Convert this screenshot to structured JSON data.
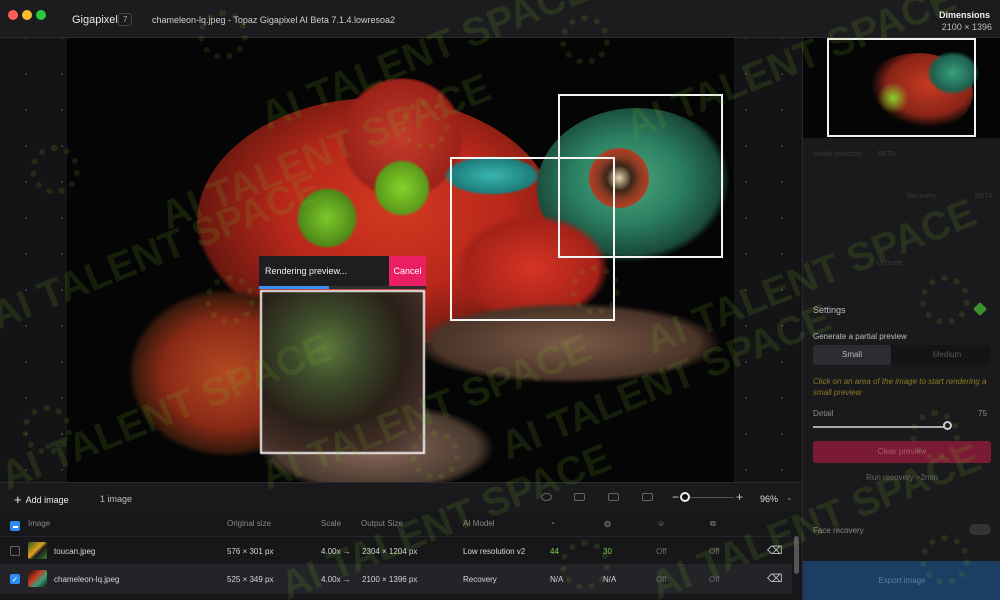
{
  "titlebar": {
    "app_name": "Gigapixel",
    "app_count": "7",
    "window_title": "chameleon-lq.jpeg - Topaz Gigapixel AI Beta 7.1.4.lowresoa2",
    "dimensions_label": "Dimensions",
    "dimensions_value": "2100 × 1396"
  },
  "preview": {
    "status_text": "Rendering preview...",
    "cancel_label": "Cancel",
    "progress_fraction": 0.42
  },
  "toolbar": {
    "add_image_label": "Add image",
    "image_count": "1 image",
    "zoom_value": "96%",
    "icons": [
      "eye-icon",
      "single-view-icon",
      "split-view-icon",
      "side-by-side-icon"
    ]
  },
  "table": {
    "headers": [
      "Image",
      "Original size",
      "Scale",
      "Output Size",
      "AI Model"
    ],
    "rows": [
      {
        "name": "toucan.jpeg",
        "original": "576 × 301 px",
        "scale": "4.00x →",
        "output": "2304 × 1204 px",
        "model": "Low resolution v2",
        "val1": "44",
        "val2": "30",
        "val3": "Off",
        "val4": "Off",
        "checked": false
      },
      {
        "name": "chameleon-lq.jpeg",
        "original": "525 × 349 px",
        "scale": "4.00x →",
        "output": "2100 × 1396 px",
        "model": "Recovery",
        "val1": "N/A",
        "val2": "N/A",
        "val3": "Off",
        "val4": "Off",
        "checked": true
      }
    ]
  },
  "panel": {
    "settings_title": "Settings",
    "partial_label": "Generate a partial preview",
    "seg_small": "Small",
    "seg_medium": "Medium",
    "hint": "Click on an area of the image to start rendering a small preview",
    "detail_label": "Detail",
    "detail_value": "75",
    "detail_fraction": 0.75,
    "clear_preview": "Clear preview",
    "run_recovery": "Run recovery ~2min",
    "face_recovery": "Face recovery",
    "export_label": "Export image",
    "recovery_label": "Recovery",
    "beta_label": "BETA"
  },
  "colors": {
    "accent_pink": "#e91e63",
    "accent_blue": "#2d8cf0",
    "value_green": "#7bd34b"
  },
  "watermark": "AI TALENT SPACE"
}
